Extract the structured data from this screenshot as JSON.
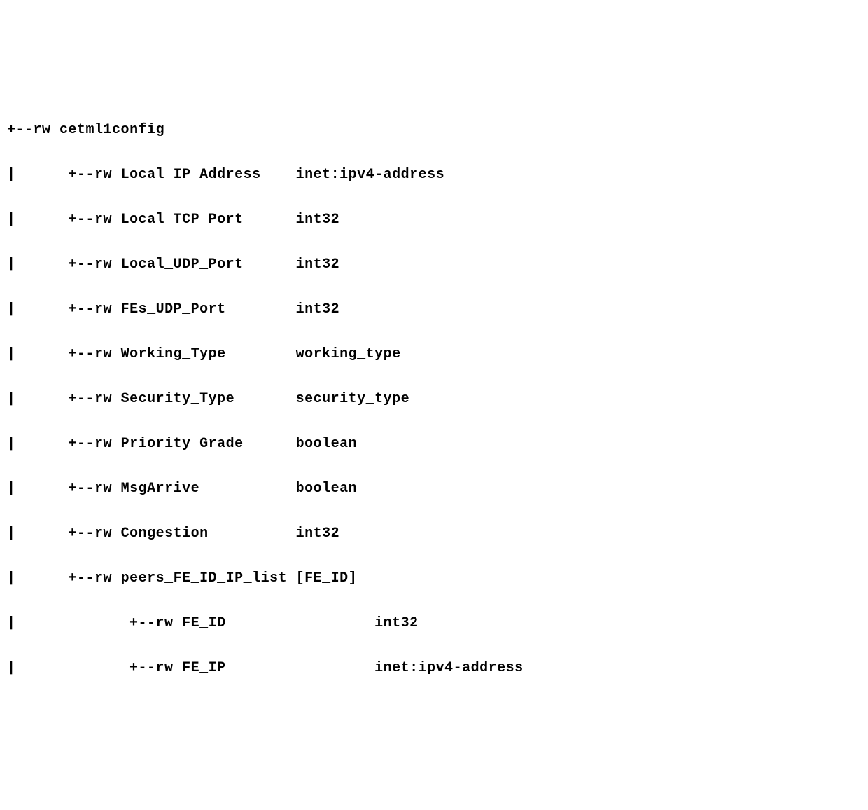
{
  "tree": {
    "root": {
      "prefix": "+--",
      "perm": "rw",
      "name": "cetml1config",
      "type": ""
    },
    "children": [
      {
        "prefix": "|      +--",
        "perm": "rw",
        "name": "Local_IP_Address   ",
        "type": "inet:ipv4-address"
      },
      {
        "prefix": "|      +--",
        "perm": "rw",
        "name": "Local_TCP_Port     ",
        "type": "int32"
      },
      {
        "prefix": "|      +--",
        "perm": "rw",
        "name": "Local_UDP_Port     ",
        "type": "int32"
      },
      {
        "prefix": "|      +--",
        "perm": "rw",
        "name": "FEs_UDP_Port       ",
        "type": "int32"
      },
      {
        "prefix": "|      +--",
        "perm": "rw",
        "name": "Working_Type       ",
        "type": "working_type"
      },
      {
        "prefix": "|      +--",
        "perm": "rw",
        "name": "Security_Type      ",
        "type": "security_type"
      },
      {
        "prefix": "|      +--",
        "perm": "rw",
        "name": "Priority_Grade     ",
        "type": "boolean"
      },
      {
        "prefix": "|      +--",
        "perm": "rw",
        "name": "MsgArrive          ",
        "type": "boolean"
      },
      {
        "prefix": "|      +--",
        "perm": "rw",
        "name": "Congestion         ",
        "type": "int32"
      },
      {
        "prefix": "|      +--",
        "perm": "rw",
        "name": "peers_FE_ID_IP_list",
        "type": " [FE_ID]"
      }
    ],
    "subchildren": [
      {
        "prefix": "|             +--",
        "perm": "rw",
        "name": "FE_ID              ",
        "type": "  int32"
      },
      {
        "prefix": "|             +--",
        "perm": "rw",
        "name": "FE_IP              ",
        "type": "  inet:ipv4-address"
      }
    ]
  }
}
